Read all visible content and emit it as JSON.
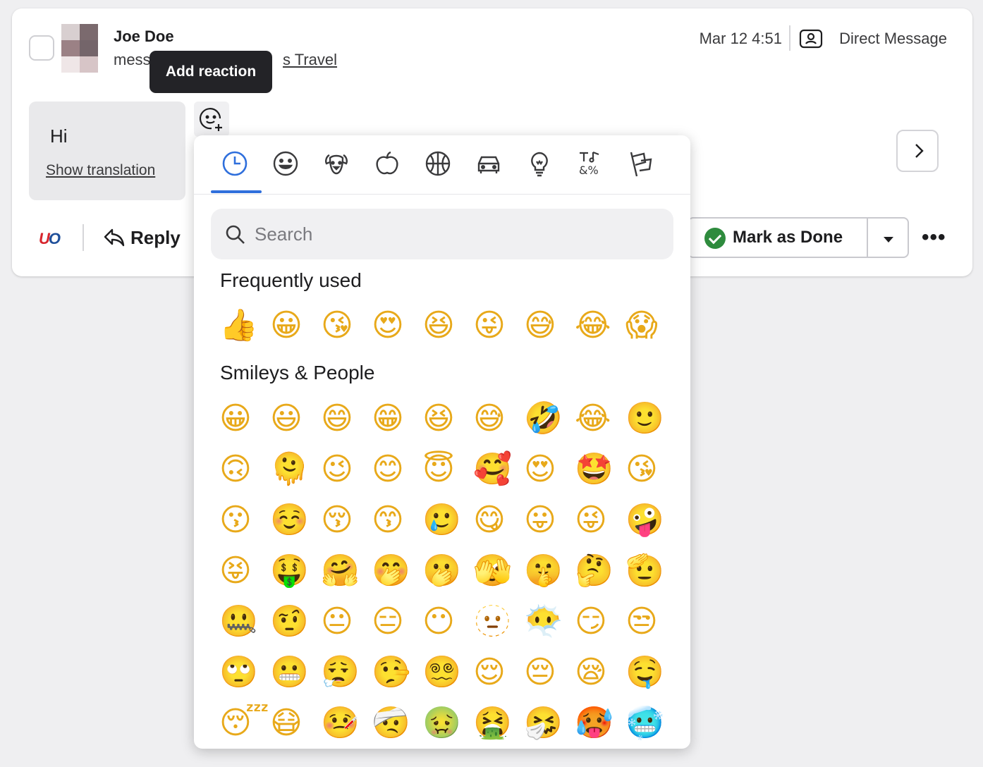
{
  "message": {
    "sender": "Joe Doe",
    "subject_visible_start": "mess",
    "subject_visible_end": "s Travel",
    "timestamp": "Mar 12 4:51",
    "channel": "Direct Message",
    "body": "Hi",
    "translation_link": "Show translation"
  },
  "actions": {
    "reply_label": "Reply",
    "mark_done_label": "Mark as Done",
    "more_label": "•••"
  },
  "tooltip": {
    "text": "Add reaction"
  },
  "picker": {
    "categories": [
      "recent",
      "smileys",
      "animals",
      "food",
      "activity",
      "travel",
      "objects",
      "symbols",
      "flags"
    ],
    "active_category": "recent",
    "search_placeholder": "Search",
    "sections": [
      {
        "title": "Frequently used",
        "rows": [
          [
            "👍",
            "😀",
            "😘",
            "😍",
            "😆",
            "😜",
            "😅",
            "😂",
            "😱"
          ]
        ]
      },
      {
        "title": "Smileys & People",
        "rows": [
          [
            "😀",
            "😃",
            "😄",
            "😁",
            "😆",
            "😅",
            "🤣",
            "😂",
            "🙂"
          ],
          [
            "🙃",
            "🫠",
            "😉",
            "😊",
            "😇",
            "🥰",
            "😍",
            "🤩",
            "😘"
          ],
          [
            "😗",
            "☺️",
            "😚",
            "😙",
            "🥲",
            "😋",
            "😛",
            "😜",
            "🤪"
          ],
          [
            "😝",
            "🤑",
            "🤗",
            "🤭",
            "🫢",
            "🫣",
            "🤫",
            "🤔",
            "🫡"
          ],
          [
            "🤐",
            "🤨",
            "😐",
            "😑",
            "😶",
            "🫥",
            "😶‍🌫️",
            "😏",
            "😒"
          ],
          [
            "🙄",
            "😬",
            "😮‍💨",
            "🤥",
            "😵‍💫",
            "😌",
            "😔",
            "😪",
            "🤤"
          ],
          [
            "😴",
            "😷",
            "🤒",
            "🤕",
            "🤢",
            "🤮",
            "🤧",
            "🥵",
            "🥶"
          ]
        ]
      }
    ]
  },
  "colors": {
    "accent": "#2f6fdc",
    "done_green": "#2e8b3d",
    "tooltip_bg": "#232327"
  }
}
